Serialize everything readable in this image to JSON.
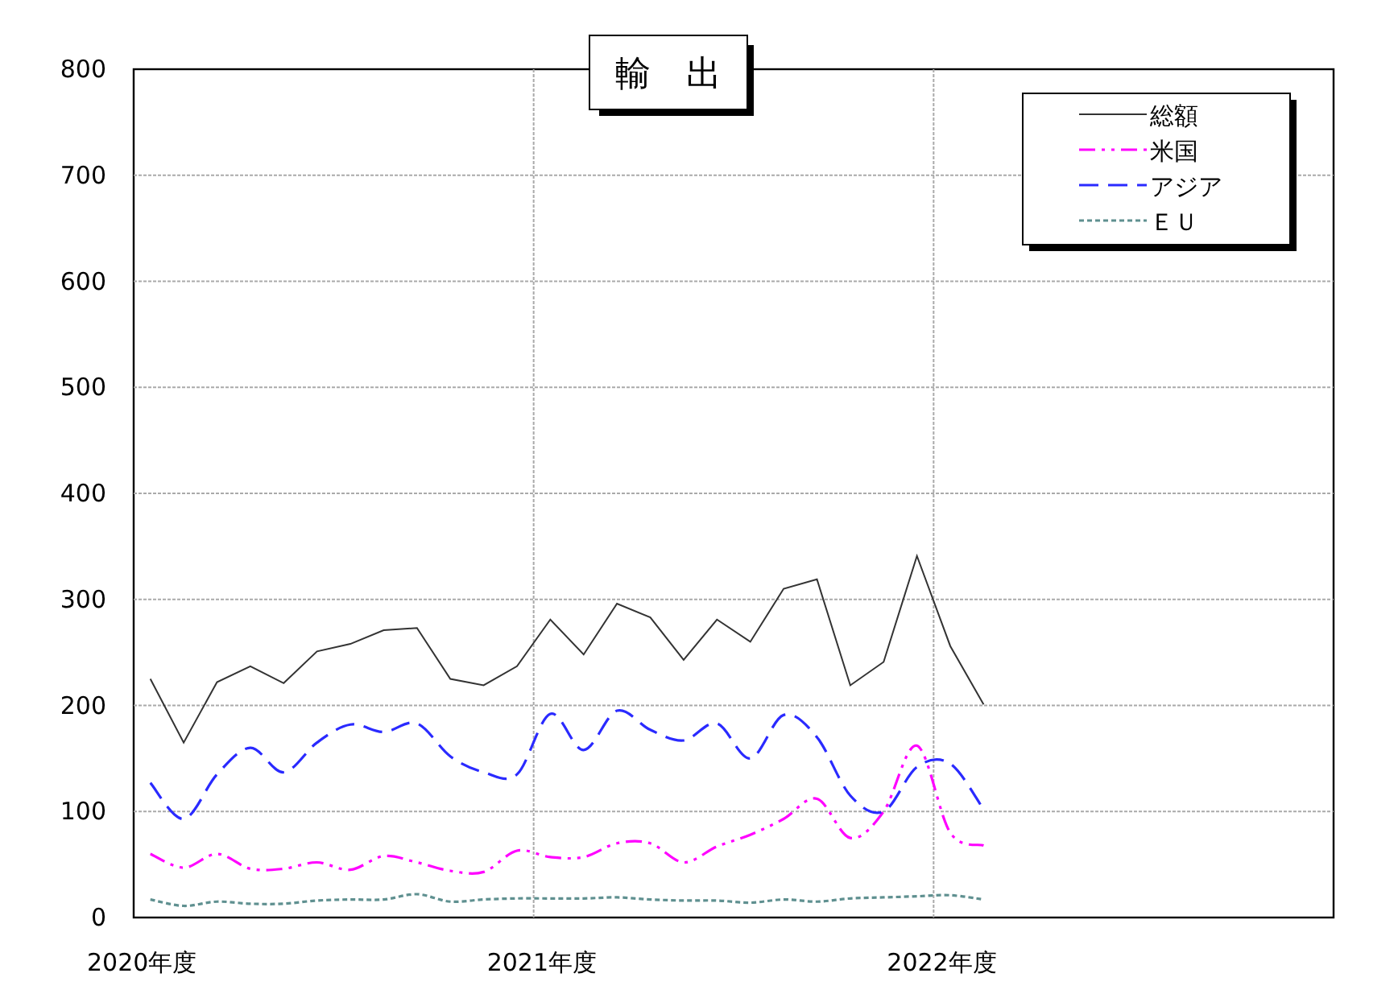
{
  "chart": {
    "chart_data": {
      "type": "line",
      "title": "輸　出",
      "categories": [
        "2020年度",
        null,
        null,
        null,
        null,
        null,
        null,
        null,
        null,
        null,
        null,
        null,
        "2021年度",
        null,
        null,
        null,
        null,
        null,
        null,
        null,
        null,
        null,
        null,
        null,
        "2022年度",
        null,
        null,
        null,
        null,
        null,
        null,
        null,
        null,
        null,
        null,
        null
      ],
      "series": [
        {
          "name": "総額",
          "color": "#333333",
          "line_style": "solid",
          "values": [
            225,
            165,
            222,
            237,
            221,
            251,
            258,
            271,
            273,
            225,
            219,
            237,
            281,
            248,
            296,
            283,
            243,
            281,
            260,
            310,
            319,
            219,
            241,
            341,
            256,
            201,
            null,
            null,
            null,
            null,
            null,
            null,
            null,
            null,
            null,
            null
          ]
        },
        {
          "name": "米国",
          "color": "#ff00ff",
          "line_style": "dashdot",
          "values": [
            60,
            47,
            60,
            46,
            46,
            52,
            45,
            58,
            52,
            44,
            43,
            63,
            57,
            57,
            70,
            70,
            52,
            67,
            78,
            93,
            112,
            75,
            100,
            162,
            80,
            68,
            null,
            null,
            null,
            null,
            null,
            null,
            null,
            null,
            null,
            null
          ]
        },
        {
          "name": "アジア",
          "color": "#2a2aff",
          "line_style": "dashed",
          "values": [
            127,
            93,
            135,
            160,
            137,
            165,
            182,
            175,
            183,
            152,
            137,
            135,
            192,
            158,
            195,
            177,
            167,
            183,
            150,
            191,
            170,
            115,
            100,
            142,
            145,
            102,
            null,
            null,
            null,
            null,
            null,
            null,
            null,
            null,
            null,
            null
          ]
        },
        {
          "name": "ＥＵ",
          "color": "#5f9090",
          "line_style": "dotted",
          "values": [
            17,
            11,
            15,
            13,
            13,
            16,
            17,
            17,
            22,
            15,
            17,
            18,
            18,
            18,
            19,
            17,
            16,
            16,
            14,
            17,
            15,
            18,
            19,
            20,
            21,
            17,
            null,
            null,
            null,
            null,
            null,
            null,
            null,
            null,
            null,
            null
          ]
        }
      ],
      "ylim": [
        0,
        800
      ],
      "grid": true,
      "legend": true,
      "yticks": [
        0,
        100,
        200,
        300,
        400,
        500,
        600,
        700,
        800
      ]
    }
  }
}
